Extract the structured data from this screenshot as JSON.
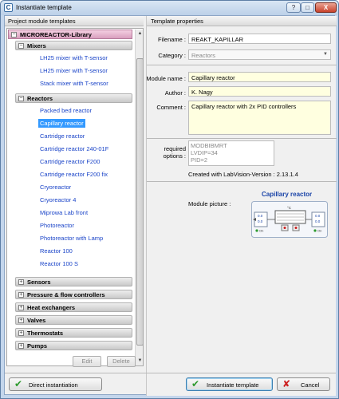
{
  "window": {
    "title": "Instantiate template",
    "help_label": "?",
    "maximize_label": "□",
    "close_label": "X"
  },
  "left_panel": {
    "header": "Project module templates",
    "library": "MICROREACTOR-Library",
    "groups": [
      {
        "label": "Mixers",
        "expanded": true,
        "items": [
          "LH25 mixer with T-sensor",
          "LH25 mixer with T-sensor",
          "Stack mixer with T-sensor"
        ]
      },
      {
        "label": "Reactors",
        "expanded": true,
        "items": [
          "Packed bed reactor",
          "Capillary reactor",
          "Cartridge reactor",
          "Cartridge reactor 240-01F",
          "Cartridge reactor F200",
          "Cartridge reactor F200 fix",
          "Cryoreactor",
          "Cryoreactor 4",
          "Miprowa Lab front",
          "Photoreactor",
          "Photoreactor with Lamp",
          "Reactor 100",
          "Reactor 100 S"
        ]
      },
      {
        "label": "Sensors",
        "expanded": false,
        "items": []
      },
      {
        "label": "Pressure & flow controllers",
        "expanded": false,
        "items": []
      },
      {
        "label": "Heat exchangers",
        "expanded": false,
        "items": []
      },
      {
        "label": "Valves",
        "expanded": false,
        "items": []
      },
      {
        "label": "Thermostats",
        "expanded": false,
        "items": []
      },
      {
        "label": "Pumps",
        "expanded": false,
        "items": []
      }
    ],
    "selected_item": "Capillary reactor",
    "edit_label": "Edit",
    "delete_label": "Delete"
  },
  "right_panel": {
    "header": "Template properties",
    "filename_label": "Filename :",
    "filename_value": "REAKT_KAPILLAR",
    "category_label": "Category :",
    "category_value": "Reactors",
    "module_name_label": "Module name :",
    "module_name_value": "Capillary reactor",
    "author_label": "Author :",
    "author_value": "K. Nagy",
    "comment_label": "Comment :",
    "comment_value": "Capillary reactor with 2x PID controllers",
    "required_label_1": "required",
    "required_label_2": "options :",
    "required_options": [
      "MODBIBMRT",
      "LVDIP=34",
      "PID=2"
    ],
    "created_with": "Created with LabVision-Version : 2.13.1.4",
    "module_picture_label": "Module picture :",
    "module_picture_title": "Capillary reactor",
    "diagram": {
      "temp_unit": "°C",
      "left_top": "0.0",
      "left_bottom": "0.0",
      "right_top": "0.0",
      "right_bottom": "0.0",
      "status_on": "On"
    }
  },
  "footer": {
    "direct_label": "Direct instantiation",
    "instantiate_label": "Instantiate template",
    "cancel_label": "Cancel"
  },
  "colors": {
    "title_bar": "#c4d6ec",
    "library_row": "#d99fbe",
    "link_blue": "#1a44c8",
    "selection": "#3399ff",
    "yellow_field": "#ffffe0",
    "check_green": "#2e9a2e",
    "cancel_red": "#cc1f1f"
  }
}
